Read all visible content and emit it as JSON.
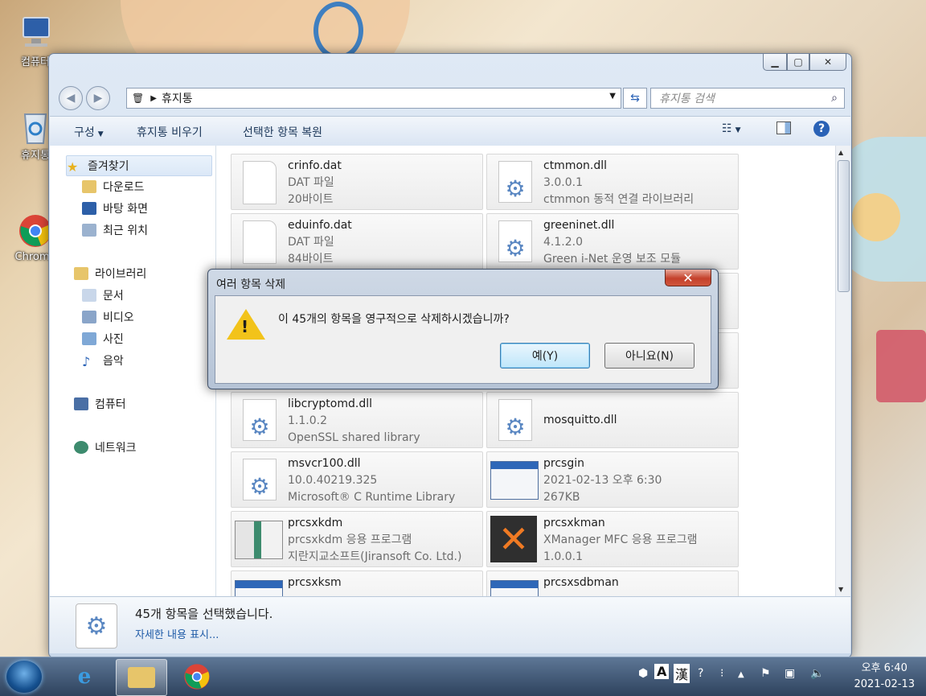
{
  "desktop": {
    "icons": [
      {
        "label": "컴퓨터",
        "icon": "computer-icon"
      },
      {
        "label": "휴지통",
        "icon": "recycle-bin-icon"
      },
      {
        "label": "Chrome",
        "icon": "chrome-icon"
      }
    ]
  },
  "window": {
    "address": {
      "location": "휴지통"
    },
    "search": {
      "placeholder": "휴지통 검색"
    },
    "commands": {
      "organize": "구성",
      "empty": "휴지통 비우기",
      "restore": "선택한 항목 복원"
    }
  },
  "nav": {
    "favorites": "즐겨찾기",
    "favorites_items": [
      "다운로드",
      "바탕 화면",
      "최근 위치"
    ],
    "libraries": "라이브러리",
    "libraries_items": [
      "문서",
      "비디오",
      "사진",
      "음악"
    ],
    "computer": "컴퓨터",
    "network": "네트워크"
  },
  "files": [
    {
      "name": "crinfo.dat",
      "l2": "DAT 파일",
      "l3": "20바이트",
      "icon": "document-icon"
    },
    {
      "name": "ctmmon.dll",
      "l2": "3.0.0.1",
      "l3": "ctmmon 동적 연결 라이브러리",
      "icon": "dll-gear-icon"
    },
    {
      "name": "eduinfo.dat",
      "l2": "DAT 파일",
      "l3": "84바이트",
      "icon": "document-icon"
    },
    {
      "name": "greeninet.dll",
      "l2": "4.1.2.0",
      "l3": "Green i-Net 운영 보조 모듈",
      "icon": "dll-gear-icon"
    },
    {
      "name": "libcryptomd.dll",
      "l2": "1.1.0.2",
      "l3": "OpenSSL shared library",
      "icon": "dll-gear-icon"
    },
    {
      "name": "mosquitto.dll",
      "l2": "",
      "l3": "",
      "icon": "dll-gear-icon"
    },
    {
      "name": "msvcr100.dll",
      "l2": "10.0.40219.325",
      "l3": "Microsoft® C Runtime Library",
      "icon": "dll-gear-icon"
    },
    {
      "name": "prcsgin",
      "l2": "2021-02-13 오후 6:30",
      "l3": "267KB",
      "icon": "app-window-icon"
    },
    {
      "name": "prcsxkdm",
      "l2": "prcsxkdm 응용 프로그램",
      "l3": "지란지교소프트(Jiransoft Co. Ltd.)",
      "icon": "app-image-icon"
    },
    {
      "name": "prcsxkman",
      "l2": "XManager MFC 응용 프로그램",
      "l3": "1.0.0.1",
      "icon": "xmanager-icon"
    },
    {
      "name": "prcsxksm",
      "l2": "",
      "l3": "",
      "icon": "app-window-icon"
    },
    {
      "name": "prcsxsdbman",
      "l2": "",
      "l3": "",
      "icon": "app-window-icon"
    }
  ],
  "details": {
    "line1": "45개 항목을 선택했습니다.",
    "line2": "자세한 내용 표시..."
  },
  "dialog": {
    "title": "여러 항목 삭제",
    "message": "이 45개의 항목을 영구적으로 삭제하시겠습니까?",
    "yes": "예(Y)",
    "no": "아니요(N)"
  },
  "taskbar": {
    "time": "오후 6:40",
    "date": "2021-02-13",
    "ime_a": "A",
    "ime_han": "漢"
  },
  "colors": {
    "accent": "#1f5ba7",
    "warning": "#f2c31a",
    "close": "#c4412b"
  }
}
